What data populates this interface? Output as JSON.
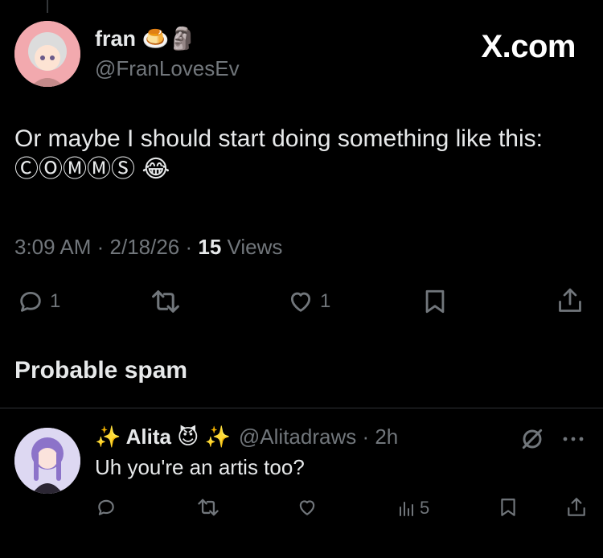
{
  "watermark": {
    "brand": "X.com"
  },
  "post": {
    "author_name": "fran",
    "author_emojis": "🍮🗿",
    "handle": "@FranLovesEv",
    "text_line1": "Or maybe I should start doing something like this:",
    "text_line2": "ⒸⓄⓂⓂⓈ 😂",
    "time": "3:09 AM",
    "date": "2/18/26",
    "views_count": "15",
    "views_label": "Views",
    "stats": {
      "replies": "1",
      "likes": "1"
    }
  },
  "section": {
    "title": "Probable spam"
  },
  "reply": {
    "name": "✨ Alita 😈 ✨",
    "handle": "@Alitadraws",
    "age": "2h",
    "text": "Uh you're an artis too?",
    "stats": {
      "views": "5"
    }
  },
  "colors": {
    "background": "#000000",
    "text": "#e7e9ea",
    "muted": "#71767b",
    "divider": "#2f3336"
  }
}
